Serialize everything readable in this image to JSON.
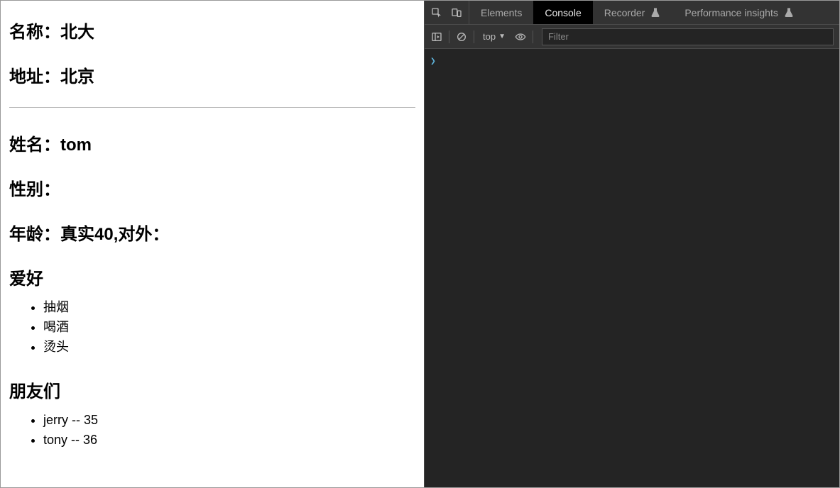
{
  "page": {
    "school": {
      "name_line": "名称：北大",
      "address_line": "地址：北京"
    },
    "person": {
      "name_line": "姓名：tom",
      "gender_line": "性别：",
      "age_line": "年龄：真实40,对外："
    },
    "hobby": {
      "heading": "爱好",
      "items": [
        "抽烟",
        "喝酒",
        "烫头"
      ]
    },
    "friends": {
      "heading": "朋友们",
      "items": [
        "jerry -- 35",
        "tony -- 36"
      ]
    }
  },
  "devtools": {
    "tabs": {
      "elements": "Elements",
      "console": "Console",
      "recorder": "Recorder",
      "performance": "Performance insights"
    },
    "toolbar": {
      "context": "top",
      "filter_placeholder": "Filter"
    },
    "console": {
      "prompt": "❯"
    }
  }
}
